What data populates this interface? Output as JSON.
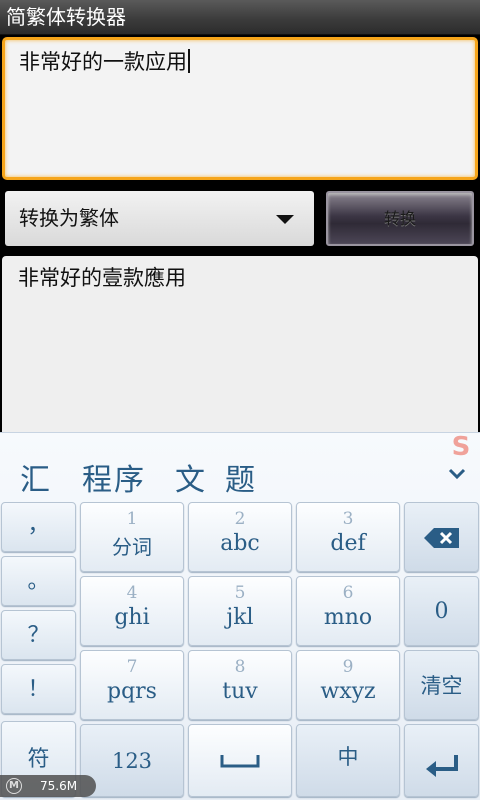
{
  "app": {
    "title": "简繁体转换器"
  },
  "input": {
    "text": "非常好的一款应用"
  },
  "conversion": {
    "mode_label": "转换为繁体",
    "convert_label": "转换"
  },
  "output": {
    "text": "非常好的壹款應用"
  },
  "ime": {
    "candidates": [
      "汇",
      "程序",
      "文",
      "题"
    ],
    "logo": "S",
    "punct_keys": [
      "，",
      "。",
      "？",
      "！"
    ],
    "sym_key": "符",
    "num_keys": [
      {
        "num": "1",
        "letters": "分词"
      },
      {
        "num": "2",
        "letters": "abc"
      },
      {
        "num": "3",
        "letters": "def"
      },
      {
        "num": "4",
        "letters": "ghi"
      },
      {
        "num": "5",
        "letters": "jkl"
      },
      {
        "num": "6",
        "letters": "mno"
      },
      {
        "num": "7",
        "letters": "pqrs"
      },
      {
        "num": "8",
        "letters": "tuv"
      },
      {
        "num": "9",
        "letters": "wxyz"
      }
    ],
    "zero_key": "0",
    "clear_key": "清空",
    "mode_123": "123",
    "lang_key": "中",
    "accent_color": "#2a5d86"
  },
  "status": {
    "memory": "75.6M"
  }
}
